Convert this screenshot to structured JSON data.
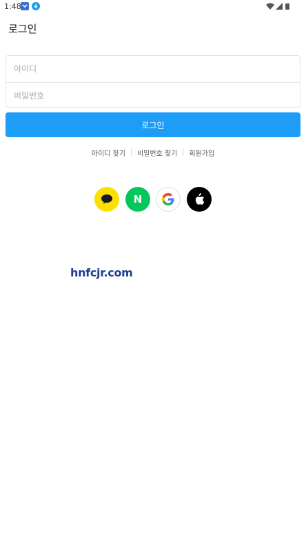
{
  "status_bar": {
    "time": "1:48"
  },
  "header": {
    "title": "로그인"
  },
  "form": {
    "id_placeholder": "아이디",
    "password_placeholder": "비밀번호",
    "submit_label": "로그인"
  },
  "links": {
    "find_id": "아이디 찾기",
    "find_password": "비밀번호 찾기",
    "signup": "회원가입"
  },
  "social": {
    "naver_letter": "N",
    "colors": {
      "kakao": "#fae100",
      "naver": "#03c75a",
      "apple": "#000000"
    },
    "icons": [
      "speech-bubble-icon",
      "naver-n-icon",
      "google-g-icon",
      "apple-icon"
    ]
  },
  "watermark": "hnfcjr.com",
  "colors": {
    "accent": "#1e9df7"
  }
}
